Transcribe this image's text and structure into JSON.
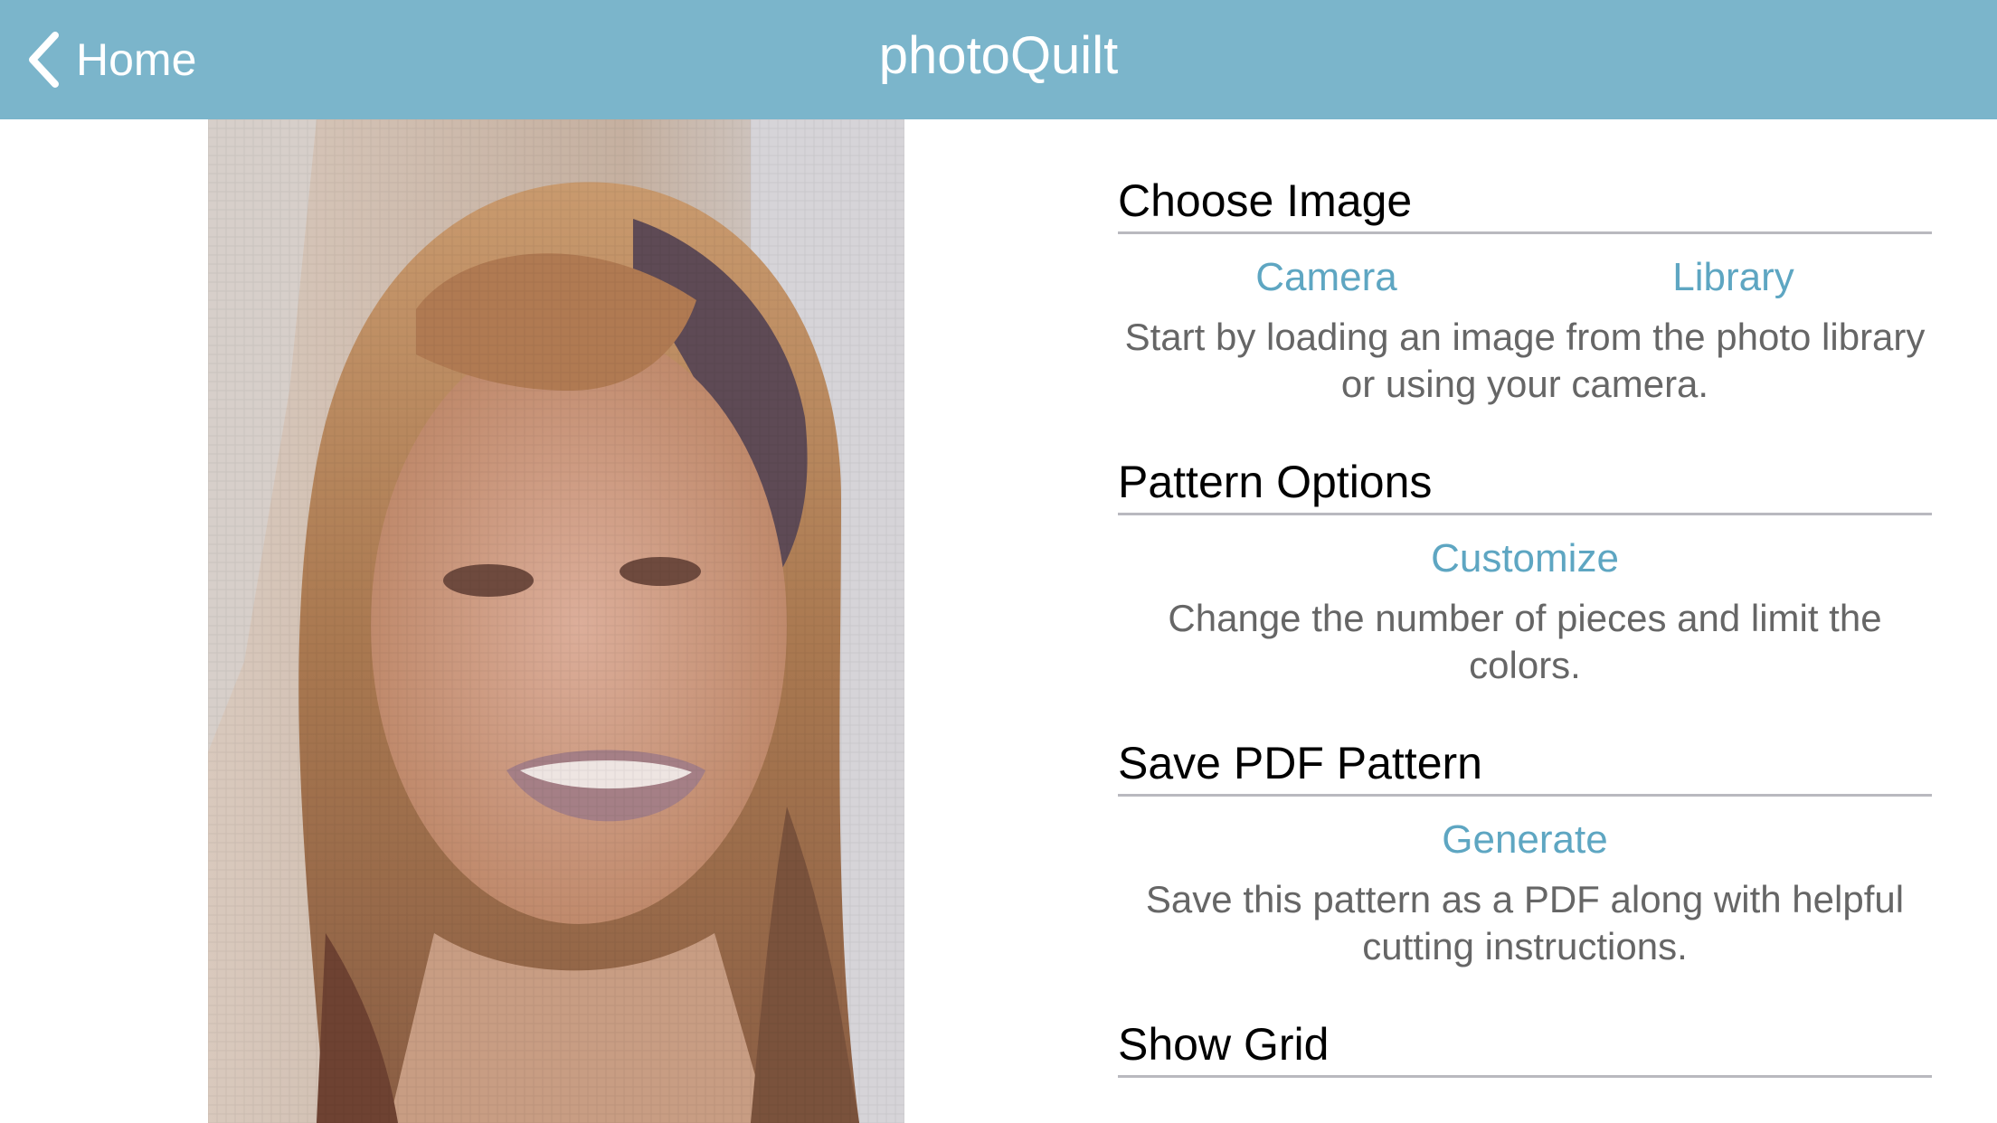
{
  "nav": {
    "back_label": "Home",
    "title": "photoQuilt"
  },
  "colors": {
    "nav_background": "#7bb5cb",
    "link": "#5ea6c2",
    "description_text": "#666666",
    "divider": "#b9b9bf"
  },
  "sections": [
    {
      "header": "Choose Image",
      "actions": [
        "Camera",
        "Library"
      ],
      "description": "Start by loading an image from the photo library or using your camera."
    },
    {
      "header": "Pattern Options",
      "actions": [
        "Customize"
      ],
      "description": "Change the number of pieces and limit the colors."
    },
    {
      "header": "Save PDF Pattern",
      "actions": [
        "Generate"
      ],
      "description": "Save this pattern as a PDF along with helpful cutting instructions."
    },
    {
      "header": "Show Grid"
    }
  ],
  "icons": {
    "back": "chevron-left-icon"
  }
}
